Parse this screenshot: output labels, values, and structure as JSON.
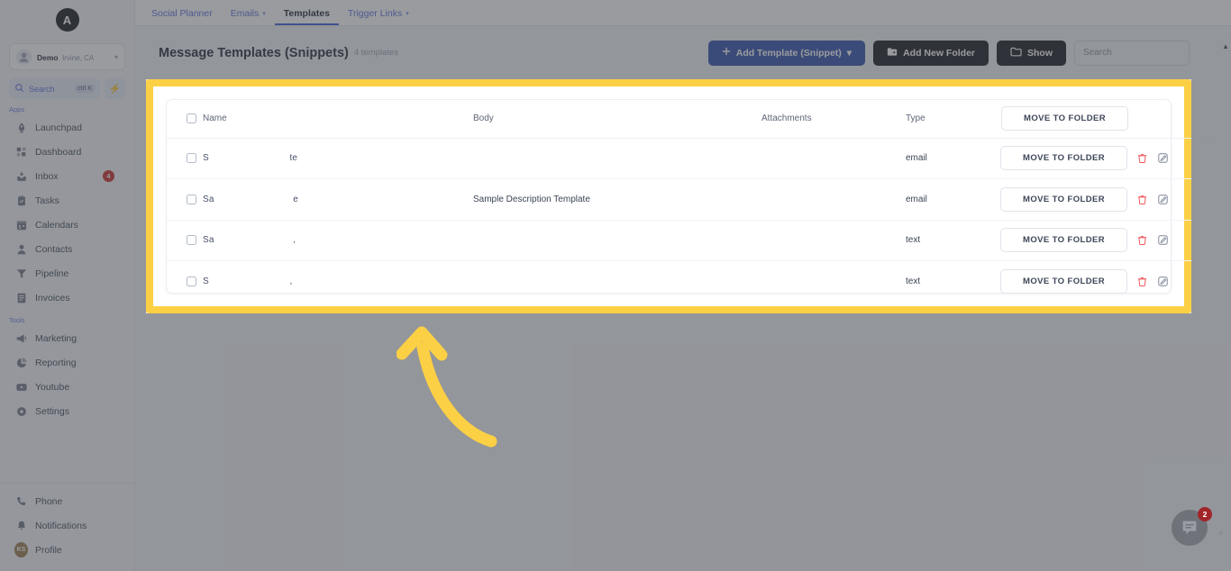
{
  "brand": {
    "logo_letter": "A",
    "accent": "#3b5bdb",
    "highlight": "#fcd045"
  },
  "sidebar": {
    "location": {
      "name": "Demo",
      "sub": "Irvine, CA"
    },
    "search": {
      "label": "Search",
      "shortcut": "ctrl K"
    },
    "groups": [
      {
        "label": "Apps",
        "items": [
          {
            "label": "Launchpad",
            "icon": "rocket-icon",
            "badge": ""
          },
          {
            "label": "Dashboard",
            "icon": "grid-icon",
            "badge": ""
          },
          {
            "label": "Inbox",
            "icon": "inbox-icon",
            "badge": "4"
          },
          {
            "label": "Tasks",
            "icon": "clipboard-icon",
            "badge": ""
          },
          {
            "label": "Calendars",
            "icon": "calendar-icon",
            "badge": ""
          },
          {
            "label": "Contacts",
            "icon": "person-icon",
            "badge": ""
          },
          {
            "label": "Pipeline",
            "icon": "funnel-icon",
            "badge": ""
          },
          {
            "label": "Invoices",
            "icon": "invoice-icon",
            "badge": ""
          }
        ]
      },
      {
        "label": "Tools",
        "items": [
          {
            "label": "Marketing",
            "icon": "megaphone-icon",
            "badge": ""
          },
          {
            "label": "Reporting",
            "icon": "pie-chart-icon",
            "badge": ""
          },
          {
            "label": "Youtube",
            "icon": "youtube-icon",
            "badge": ""
          },
          {
            "label": "Settings",
            "icon": "gear-icon",
            "badge": ""
          }
        ]
      }
    ],
    "bottom": [
      {
        "label": "Phone",
        "icon": "phone-icon"
      },
      {
        "label": "Notifications",
        "icon": "bell-icon"
      },
      {
        "label": "Profile",
        "icon": "avatar-icon",
        "initials": "KS"
      }
    ]
  },
  "topbar": {
    "menu_icon": "hamburger-icon",
    "tabs": [
      {
        "label": "Social Planner",
        "caret": false,
        "active": false
      },
      {
        "label": "Emails",
        "caret": true,
        "active": false
      },
      {
        "label": "Templates",
        "caret": false,
        "active": true
      },
      {
        "label": "Trigger Links",
        "caret": true,
        "active": false
      }
    ]
  },
  "page": {
    "title": "Message Templates (Snippets)",
    "count_label": "4 templates",
    "buttons": {
      "add_template": "Add Template (Snippet)",
      "add_template_icon": "plus-icon",
      "add_template_caret": "chevron-down-icon",
      "add_folder": "Add New Folder",
      "add_folder_icon": "folder-plus-icon",
      "show": "Show",
      "show_icon": "folder-icon"
    },
    "search": {
      "placeholder": "Search",
      "value": "",
      "icon": "search-icon"
    }
  },
  "table": {
    "headers": {
      "name": "Name",
      "body": "Body",
      "attachments": "Attachments",
      "type": "Type",
      "move_to_folder": "MOVE TO FOLDER"
    },
    "rows": [
      {
        "name_fragment_start": "S",
        "name_fragment_mid": "",
        "name_fragment_end": "te",
        "body": "",
        "attachments": "",
        "type": "email",
        "action": "MOVE TO FOLDER",
        "delete_icon": "trash-icon",
        "edit_icon": "edit-square-icon"
      },
      {
        "name_fragment_start": "Sa",
        "name_fragment_mid": "",
        "name_fragment_end": "e",
        "body": "Sample Description Template",
        "attachments": "",
        "type": "email",
        "action": "MOVE TO FOLDER",
        "delete_icon": "trash-icon",
        "edit_icon": "edit-square-icon"
      },
      {
        "name_fragment_start": "Sa",
        "name_fragment_mid": "",
        "name_fragment_end": ",",
        "body": "",
        "attachments": "",
        "type": "text",
        "action": "MOVE TO FOLDER",
        "delete_icon": "trash-icon",
        "edit_icon": "edit-square-icon"
      },
      {
        "name_fragment_start": "S",
        "name_fragment_mid": "",
        "name_fragment_end": ",",
        "body": "",
        "attachments": "",
        "type": "text",
        "action": "MOVE TO FOLDER",
        "delete_icon": "trash-icon",
        "edit_icon": "edit-square-icon"
      }
    ]
  },
  "annotation": {
    "arrow": "curved-up-arrow",
    "color": "#fcd045"
  },
  "chat_widget": {
    "icon": "chat-bubble-icon",
    "badge": "2",
    "caret": "chevron-down-icon"
  },
  "scrollbar": {
    "arrow": "scroll-up-arrow"
  }
}
